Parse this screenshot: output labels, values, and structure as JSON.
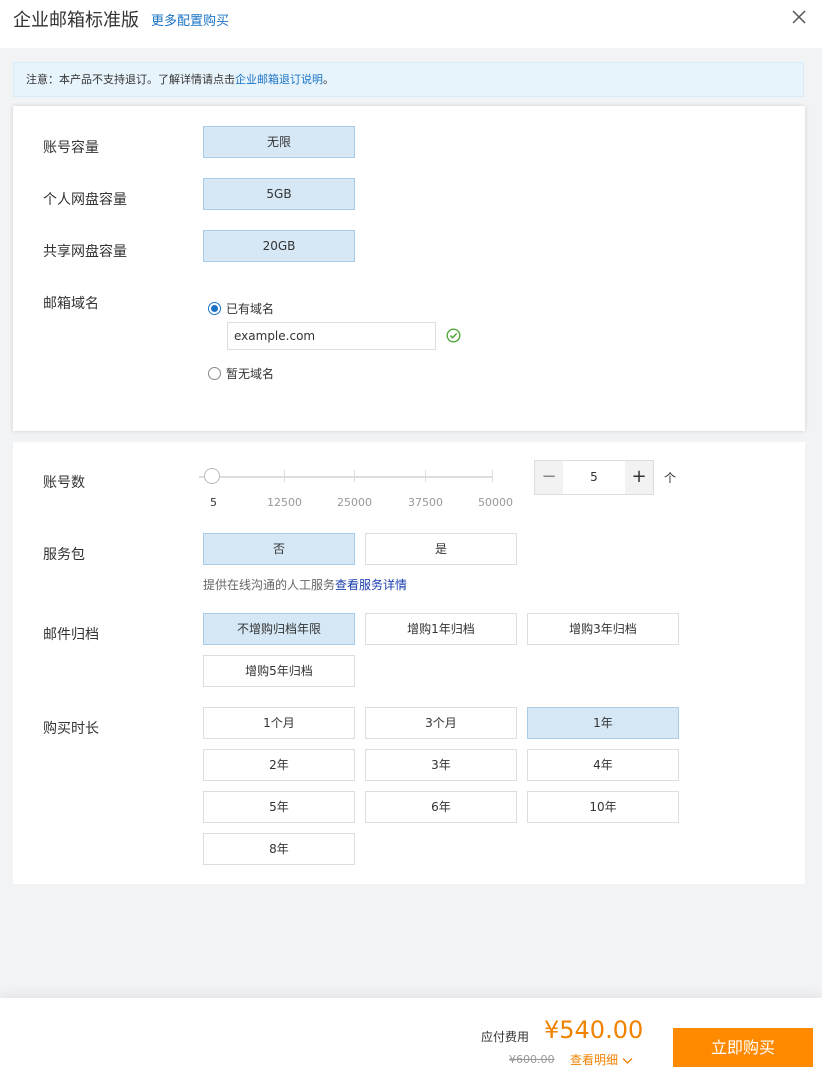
{
  "header": {
    "title": "企业邮箱标准版",
    "more_link": "更多配置购买"
  },
  "notice": {
    "text": "注意：本产品不支持退订。了解详情请点击",
    "link": "企业邮箱退订说明",
    "suffix": "。"
  },
  "specs": {
    "account_capacity": {
      "label": "账号容量",
      "value": "无限"
    },
    "personal_disk": {
      "label": "个人网盘容量",
      "value": "5GB"
    },
    "shared_disk": {
      "label": "共享网盘容量",
      "value": "20GB"
    }
  },
  "domain": {
    "label": "邮箱域名",
    "option_has": "已有域名",
    "option_none": "暂无域名",
    "selected": "已有域名",
    "value": "example.com"
  },
  "accounts": {
    "label": "账号数",
    "ticks": [
      "5",
      "12500",
      "25000",
      "37500",
      "50000"
    ],
    "min": 5,
    "max": 50000,
    "value": "5",
    "unit": "个",
    "minus": "−",
    "plus": "+"
  },
  "service": {
    "label": "服务包",
    "options": [
      "否",
      "是"
    ],
    "selected": "否",
    "hint": "提供在线沟通的人工服务",
    "hint_link": "查看服务详情"
  },
  "archive": {
    "label": "邮件归档",
    "options": [
      "不增购归档年限",
      "增购1年归档",
      "增购3年归档",
      "增购5年归档"
    ],
    "selected": "不增购归档年限"
  },
  "duration": {
    "label": "购买时长",
    "options": [
      "1个月",
      "3个月",
      "1年",
      "2年",
      "3年",
      "4年",
      "5年",
      "6年",
      "10年",
      "8年"
    ],
    "selected": "1年"
  },
  "footer": {
    "fee_label": "应付费用",
    "price": "¥540.00",
    "original_price": "¥600.00",
    "detail_link": "查看明细",
    "buy_button": "立即购买"
  },
  "colors": {
    "accent": "#1a73c6",
    "selected_bg": "#d6e8f6",
    "price": "#f08200",
    "buy_button": "#ff8a00",
    "check": "#52a83a"
  }
}
